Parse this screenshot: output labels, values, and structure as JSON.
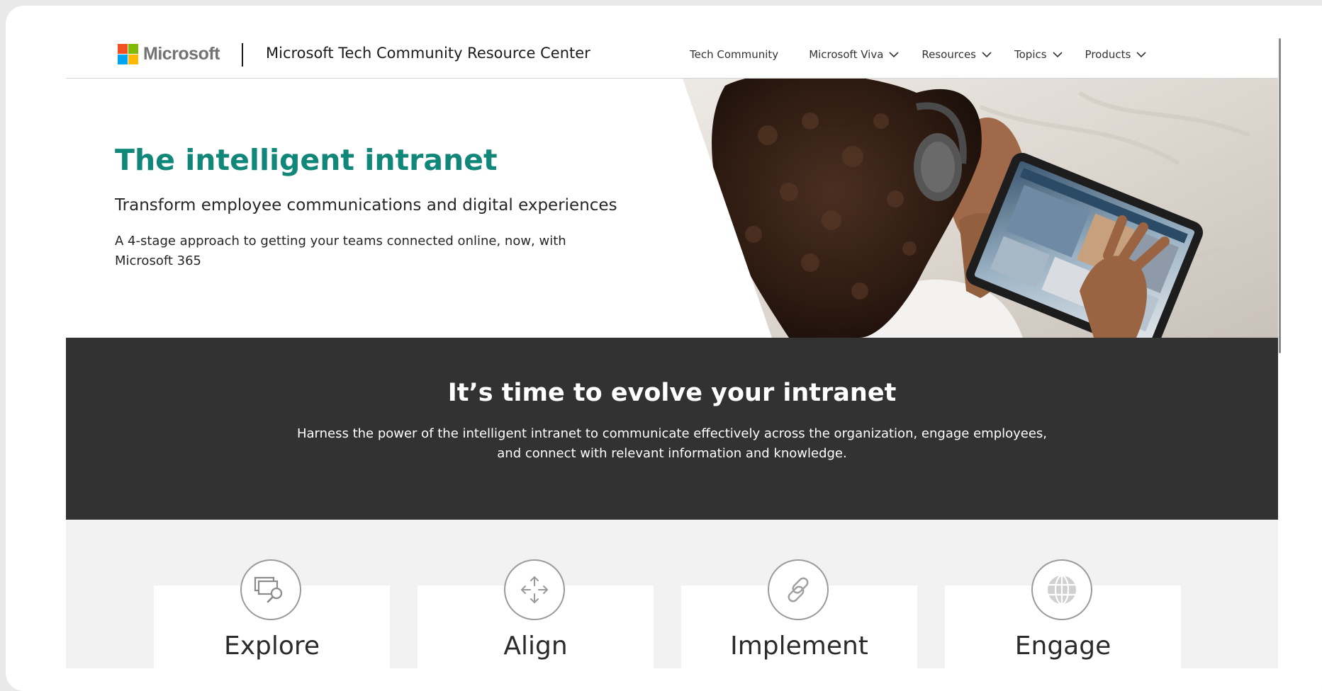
{
  "header": {
    "brand": "Microsoft",
    "site_title": "Microsoft Tech Community Resource Center",
    "logo_colors": [
      "#f25022",
      "#7fba00",
      "#00a4ef",
      "#ffb900"
    ],
    "nav": [
      {
        "label": "Tech Community",
        "dropdown": false
      },
      {
        "label": "Microsoft Viva",
        "dropdown": true
      },
      {
        "label": "Resources",
        "dropdown": true
      },
      {
        "label": "Topics",
        "dropdown": true
      },
      {
        "label": "Products",
        "dropdown": true
      }
    ]
  },
  "hero": {
    "title": "The intelligent intranet",
    "subtitle": "Transform employee communications and digital experiences",
    "description": "A 4-stage approach to getting your teams connected online, now, with Microsoft 365",
    "image_icon": "person-with-tablet-photo"
  },
  "band": {
    "title": "It’s time to evolve your intranet",
    "description": "Harness the power of the intelligent intranet to communicate effectively across the organization, engage employees, and connect with relevant information and knowledge."
  },
  "stages": [
    {
      "label": "Explore",
      "icon": "explore-search-icon"
    },
    {
      "label": "Align",
      "icon": "align-arrows-icon"
    },
    {
      "label": "Implement",
      "icon": "link-icon"
    },
    {
      "label": "Engage",
      "icon": "globe-icon"
    }
  ],
  "colors": {
    "accent_teal": "#11877a",
    "band_bg": "#323232",
    "stage_bg": "#f2f2f2"
  }
}
